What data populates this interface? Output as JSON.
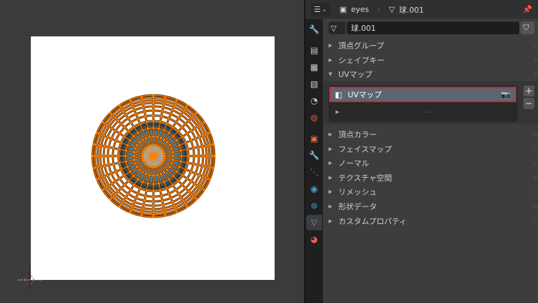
{
  "header": {
    "object_name": "eyes",
    "mesh_name": "球.001"
  },
  "mesh_field": {
    "value": "球.001"
  },
  "panels_top": [
    {
      "label": "頂点グループ",
      "expanded": false
    },
    {
      "label": "シェイプキー",
      "expanded": false
    },
    {
      "label": "UVマップ",
      "expanded": true
    }
  ],
  "uv_maps": {
    "items": [
      {
        "name": "UVマップ",
        "selected": true
      }
    ],
    "add": "+",
    "remove": "−"
  },
  "panels_bottom": [
    {
      "label": "頂点カラー"
    },
    {
      "label": "フェイスマップ"
    },
    {
      "label": "ノーマル"
    },
    {
      "label": "テクスチャ空間"
    },
    {
      "label": "リメッシュ"
    },
    {
      "label": "形状データ"
    },
    {
      "label": "カスタムプロパティ"
    }
  ],
  "colors": {
    "wire": "#ff8000",
    "highlight": "#e0202c",
    "accent": "#4f9fd0"
  }
}
